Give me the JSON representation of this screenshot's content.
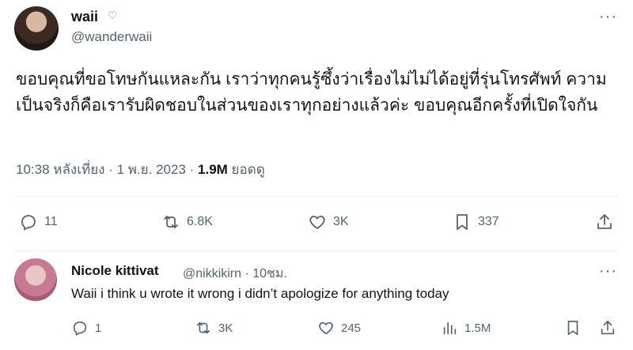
{
  "tweet": {
    "author_name": "waii",
    "author_badge": "♡",
    "handle": "@wanderwaii",
    "more": "···",
    "text": "ขอบคุณที่ขอโทษกันแหละกัน เราว่าทุกคนรู้ซึ้งว่าเรื่องไม่ไม่ได้อยู่ที่รุ่นโทรศัพท์ ความเป็นจริงก็คือเรารับผิดชอบในส่วนของเราทุกอย่างแล้วค่ะ ขอบคุณอีกครั้งที่เปิดใจกัน",
    "timestamp": "10:38 หลังเที่ยง · 1 พ.ย. 2023 · ",
    "views_count": "1.9M",
    "views_label": " ยอดดู",
    "actions": {
      "replies": "11",
      "retweets": "6.8K",
      "likes": "3K",
      "bookmarks": "337"
    }
  },
  "reply": {
    "author_name": "Nicole kittivat",
    "handle_time": "@nikkikirn · 10ชม.",
    "more": "···",
    "text": "Waii i think u wrote it wrong i didn’t apologize for anything today",
    "actions": {
      "replies": "1",
      "retweets": "3K",
      "likes": "245",
      "views": "1.5M"
    }
  }
}
